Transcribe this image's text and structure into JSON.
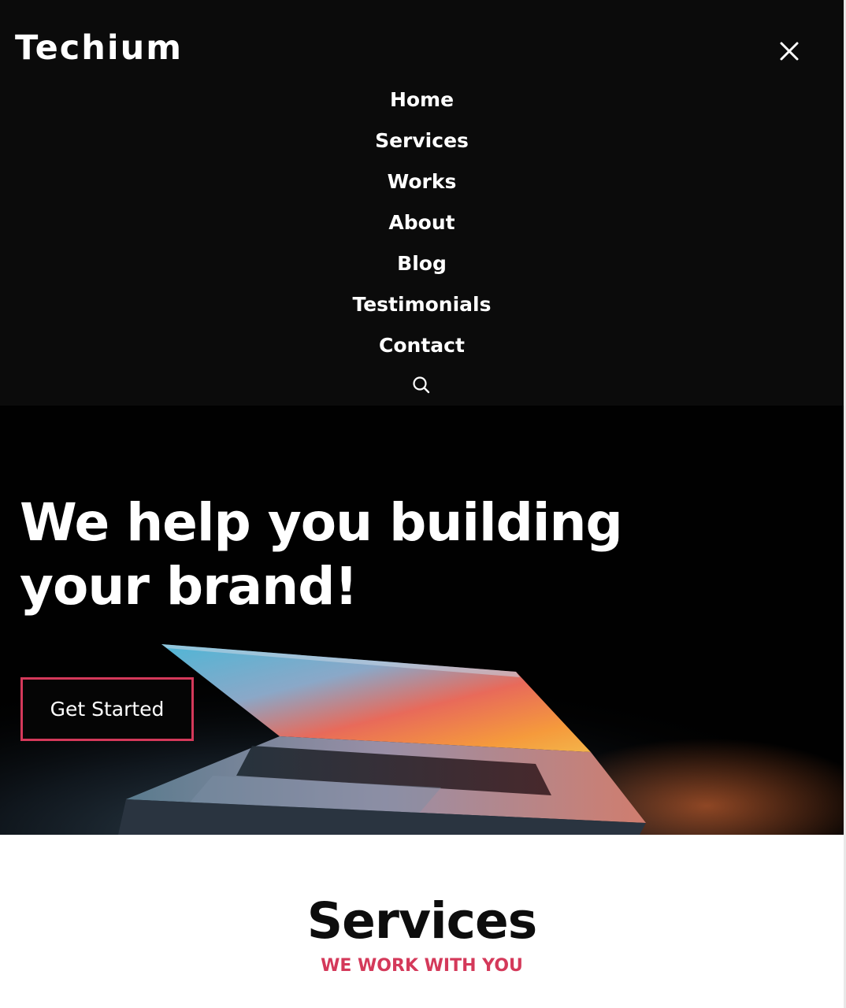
{
  "brand": {
    "logo_text": "Techium"
  },
  "nav": {
    "items": [
      {
        "label": "Home"
      },
      {
        "label": "Services"
      },
      {
        "label": "Works"
      },
      {
        "label": "About"
      },
      {
        "label": "Blog"
      },
      {
        "label": "Testimonials"
      },
      {
        "label": "Contact"
      }
    ],
    "close_icon": "close-icon",
    "search_icon": "search-icon"
  },
  "hero": {
    "title": "We help you building your brand!",
    "cta_label": "Get Started",
    "image": "laptop-photo"
  },
  "services": {
    "title": "Services",
    "subtitle": "WE WORK WITH YOU"
  },
  "colors": {
    "header_bg": "#0b0b0b",
    "hero_bg": "#010101",
    "accent": "#d4395a",
    "text_light": "#ffffff",
    "text_dark": "#0d0d0d"
  }
}
